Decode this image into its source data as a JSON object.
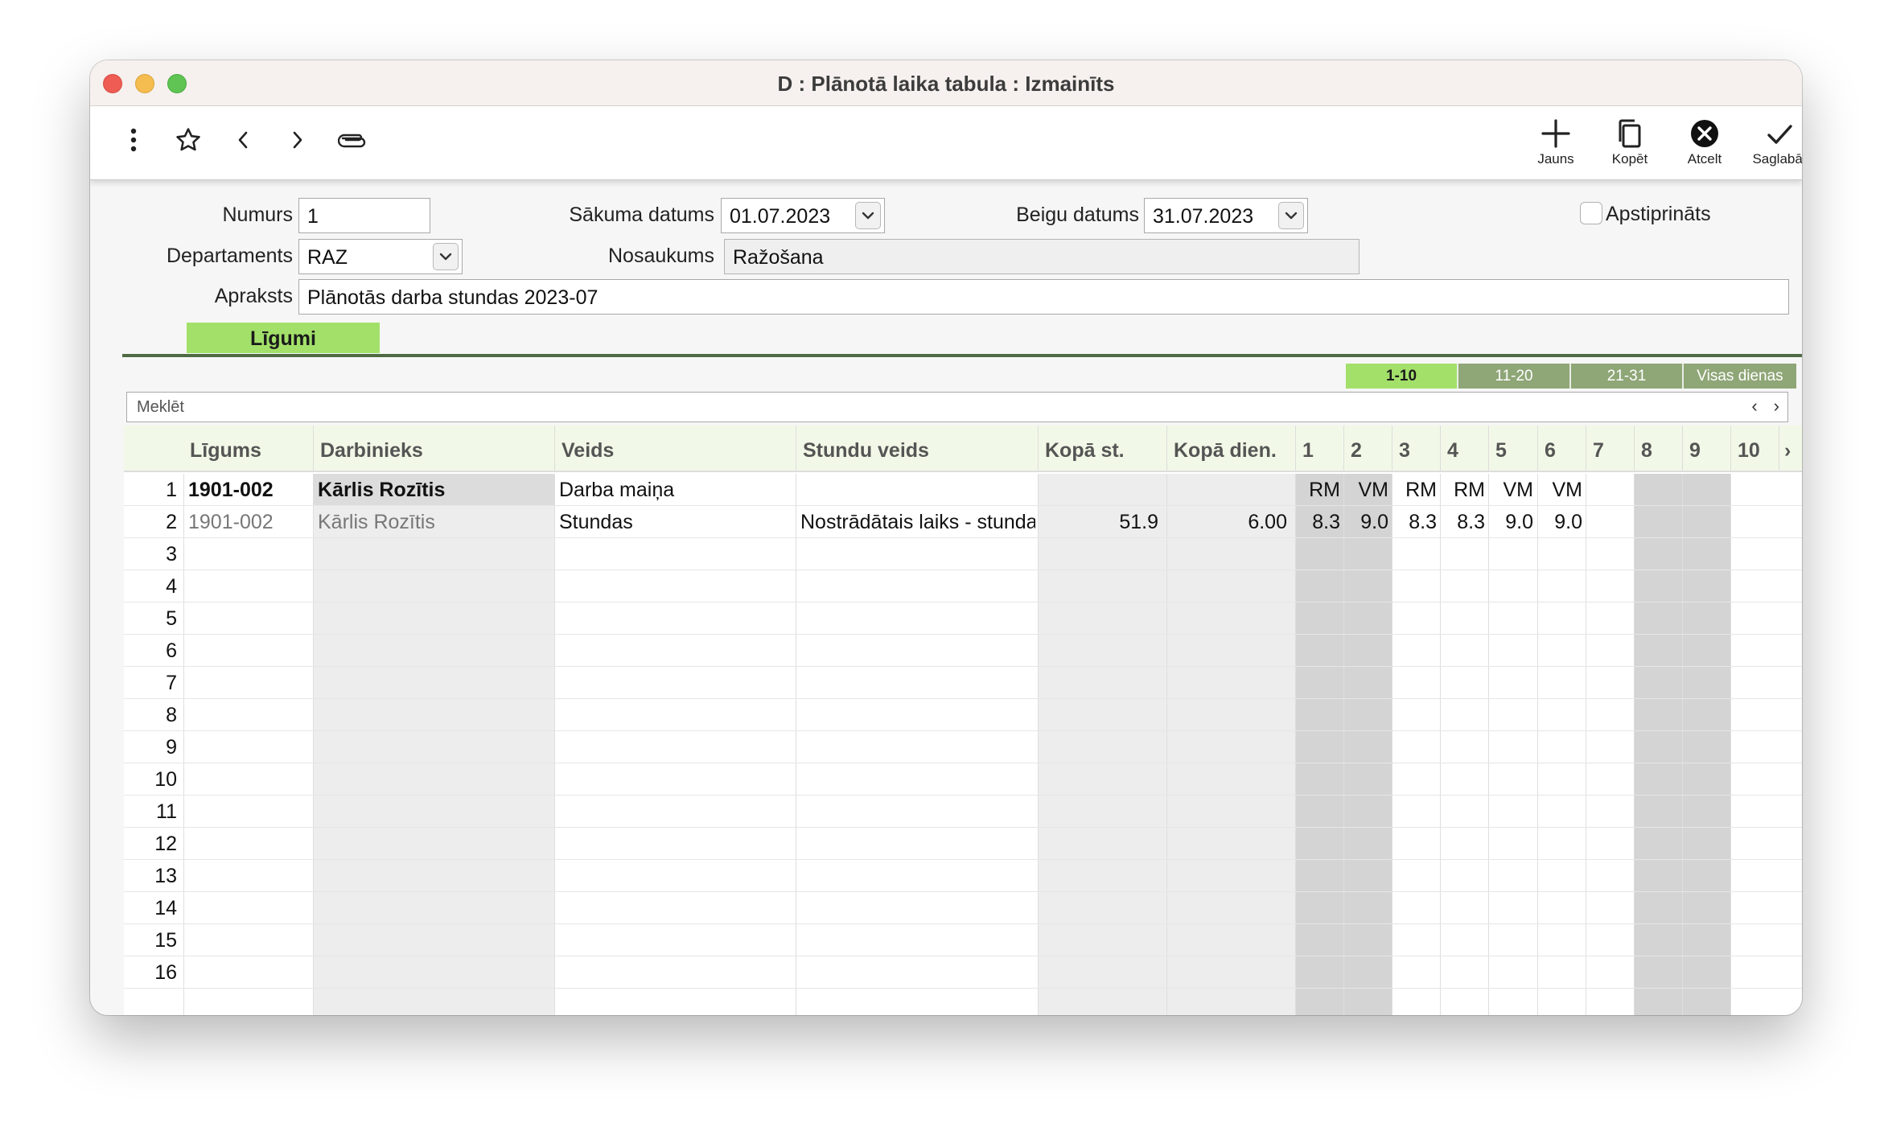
{
  "window": {
    "title": "D : Plānotā laika tabula : Izmainīts"
  },
  "toolbar": {
    "new_label": "Jauns",
    "copy_label": "Kopēt",
    "cancel_label": "Atcelt",
    "save_label": "Saglabāt"
  },
  "form": {
    "number_label": "Numurs",
    "number_value": "1",
    "start_label": "Sākuma datums",
    "start_value": "01.07.2023",
    "end_label": "Beigu datums",
    "end_value": "31.07.2023",
    "approved_label": "Apstiprināts",
    "department_label": "Departaments",
    "department_value": "RAZ",
    "name_label": "Nosaukums",
    "name_value": "Ražošana",
    "description_label": "Apraksts",
    "description_value": "Plānotās darba stundas 2023-07"
  },
  "tabs": {
    "ligumi": "Līgumi"
  },
  "day_tabs": [
    "1-10",
    "11-20",
    "21-31",
    "Visas dienas"
  ],
  "search": {
    "placeholder": "Meklēt"
  },
  "table": {
    "headers": {
      "contract": "Līgums",
      "employee": "Darbinieks",
      "type": "Veids",
      "hour_type": "Stundu veids",
      "total_hours": "Kopā st.",
      "total_days": "Kopā dien.",
      "days": [
        "1",
        "2",
        "3",
        "4",
        "5",
        "6",
        "7",
        "8",
        "9",
        "10"
      ]
    },
    "rows": [
      {
        "num": "1",
        "contract": "1901-002",
        "employee": "Kārlis Rozītis",
        "type": "Darba maiņa",
        "hour_type": "",
        "total_hours": "",
        "total_days": "",
        "days": [
          "RM",
          "VM",
          "RM",
          "RM",
          "VM",
          "VM",
          "",
          "",
          "",
          ""
        ]
      },
      {
        "num": "2",
        "contract": "1901-002",
        "employee": "Kārlis Rozītis",
        "type": "Stundas",
        "hour_type": "Nostrādātais laiks - stundas",
        "total_hours": "51.9",
        "total_days": "6.00",
        "days": [
          "8.3",
          "9.0",
          "8.3",
          "8.3",
          "9.0",
          "9.0",
          "",
          "",
          "",
          ""
        ]
      }
    ],
    "row_numbers": [
      "1",
      "2",
      "3",
      "4",
      "5",
      "6",
      "7",
      "8",
      "9",
      "10",
      "11",
      "12",
      "13",
      "14",
      "15",
      "16"
    ]
  }
}
